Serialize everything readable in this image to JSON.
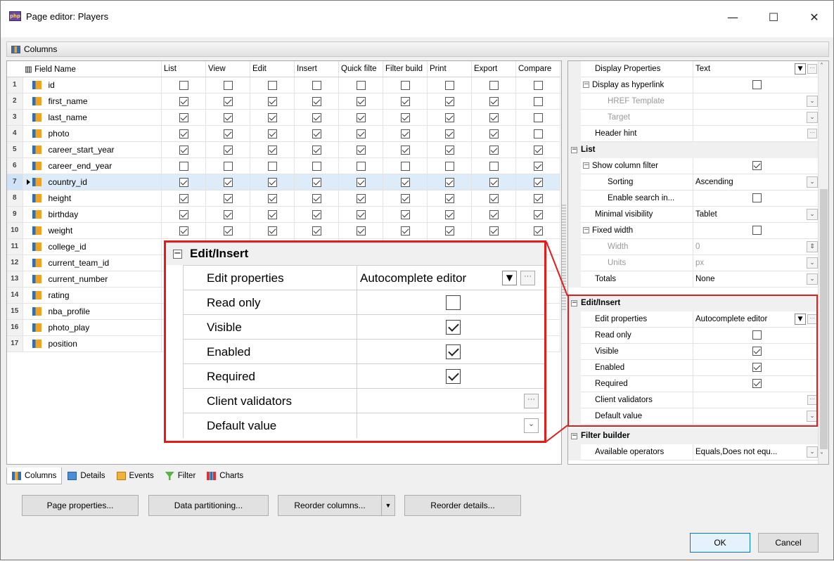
{
  "window": {
    "title": "Page editor: Players",
    "app_icon_text": "php",
    "minimize": "—",
    "maximize": "☐",
    "close": "✕"
  },
  "toolbar": {
    "label": "Columns"
  },
  "grid": {
    "headers": [
      "Field Name",
      "List",
      "View",
      "Edit",
      "Insert",
      "Quick filte",
      "Filter build",
      "Print",
      "Export",
      "Compare"
    ],
    "rows": [
      {
        "num": "1",
        "name": "id",
        "checks": [
          0,
          0,
          0,
          0,
          0,
          0,
          0,
          0,
          0
        ]
      },
      {
        "num": "2",
        "name": "first_name",
        "checks": [
          1,
          1,
          1,
          1,
          1,
          1,
          1,
          1,
          0
        ]
      },
      {
        "num": "3",
        "name": "last_name",
        "checks": [
          1,
          1,
          1,
          1,
          1,
          1,
          1,
          1,
          0
        ]
      },
      {
        "num": "4",
        "name": "photo",
        "checks": [
          1,
          1,
          1,
          1,
          1,
          1,
          1,
          1,
          0
        ]
      },
      {
        "num": "5",
        "name": "career_start_year",
        "checks": [
          1,
          1,
          1,
          1,
          1,
          1,
          1,
          1,
          1
        ]
      },
      {
        "num": "6",
        "name": "career_end_year",
        "checks": [
          0,
          0,
          0,
          0,
          0,
          0,
          0,
          0,
          1
        ]
      },
      {
        "num": "7",
        "name": "country_id",
        "checks": [
          1,
          1,
          1,
          1,
          1,
          1,
          1,
          1,
          1
        ],
        "selected": true
      },
      {
        "num": "8",
        "name": "height",
        "checks": [
          1,
          1,
          1,
          1,
          1,
          1,
          1,
          1,
          1
        ]
      },
      {
        "num": "9",
        "name": "birthday",
        "checks": [
          1,
          1,
          1,
          1,
          1,
          1,
          1,
          1,
          1
        ]
      },
      {
        "num": "10",
        "name": "weight",
        "checks": [
          1,
          1,
          1,
          1,
          1,
          1,
          1,
          1,
          1
        ]
      },
      {
        "num": "11",
        "name": "college_id",
        "checks": null
      },
      {
        "num": "12",
        "name": "current_team_id",
        "checks": null
      },
      {
        "num": "13",
        "name": "current_number",
        "checks": null
      },
      {
        "num": "14",
        "name": "rating",
        "checks": null
      },
      {
        "num": "15",
        "name": "nba_profile",
        "checks": null
      },
      {
        "num": "16",
        "name": "photo_play",
        "checks": null
      },
      {
        "num": "17",
        "name": "position",
        "checks": null
      }
    ]
  },
  "props": {
    "display_properties_label": "Display Properties",
    "display_properties_value": "Text",
    "display_as_hyperlink": "Display as hyperlink",
    "href_template": "HREF Template",
    "target": "Target",
    "header_hint": "Header hint",
    "list_cat": "List",
    "show_column_filter": "Show column filter",
    "sorting": "Sorting",
    "sorting_value": "Ascending",
    "enable_search": "Enable search in...",
    "minimal_visibility": "Minimal visibility",
    "minimal_visibility_value": "Tablet",
    "fixed_width": "Fixed width",
    "width": "Width",
    "width_value": "0",
    "units": "Units",
    "units_value": "px",
    "totals": "Totals",
    "totals_value": "None",
    "edit_insert_cat": "Edit/Insert",
    "edit_properties": "Edit properties",
    "edit_properties_value": "Autocomplete editor",
    "read_only": "Read only",
    "visible": "Visible",
    "enabled": "Enabled",
    "required": "Required",
    "client_validators": "Client validators",
    "default_value": "Default value",
    "filter_builder_cat": "Filter builder",
    "available_operators": "Available operators",
    "available_operators_value": "Equals,Does not equ..."
  },
  "zoom": {
    "title": "Edit/Insert",
    "rows": [
      {
        "label": "Edit properties",
        "value": "Autocomplete editor"
      },
      {
        "label": "Read only"
      },
      {
        "label": "Visible"
      },
      {
        "label": "Enabled"
      },
      {
        "label": "Required"
      },
      {
        "label": "Client validators"
      },
      {
        "label": "Default value"
      }
    ]
  },
  "tabs": [
    "Columns",
    "Details",
    "Events",
    "Filter",
    "Charts"
  ],
  "buttons": {
    "page_properties": "Page properties...",
    "data_partitioning": "Data partitioning...",
    "reorder_columns": "Reorder columns...",
    "reorder_details": "Reorder details...",
    "ok": "OK",
    "cancel": "Cancel"
  },
  "colors": {
    "highlight": "#e21b1b",
    "selection": "#deecf9"
  }
}
